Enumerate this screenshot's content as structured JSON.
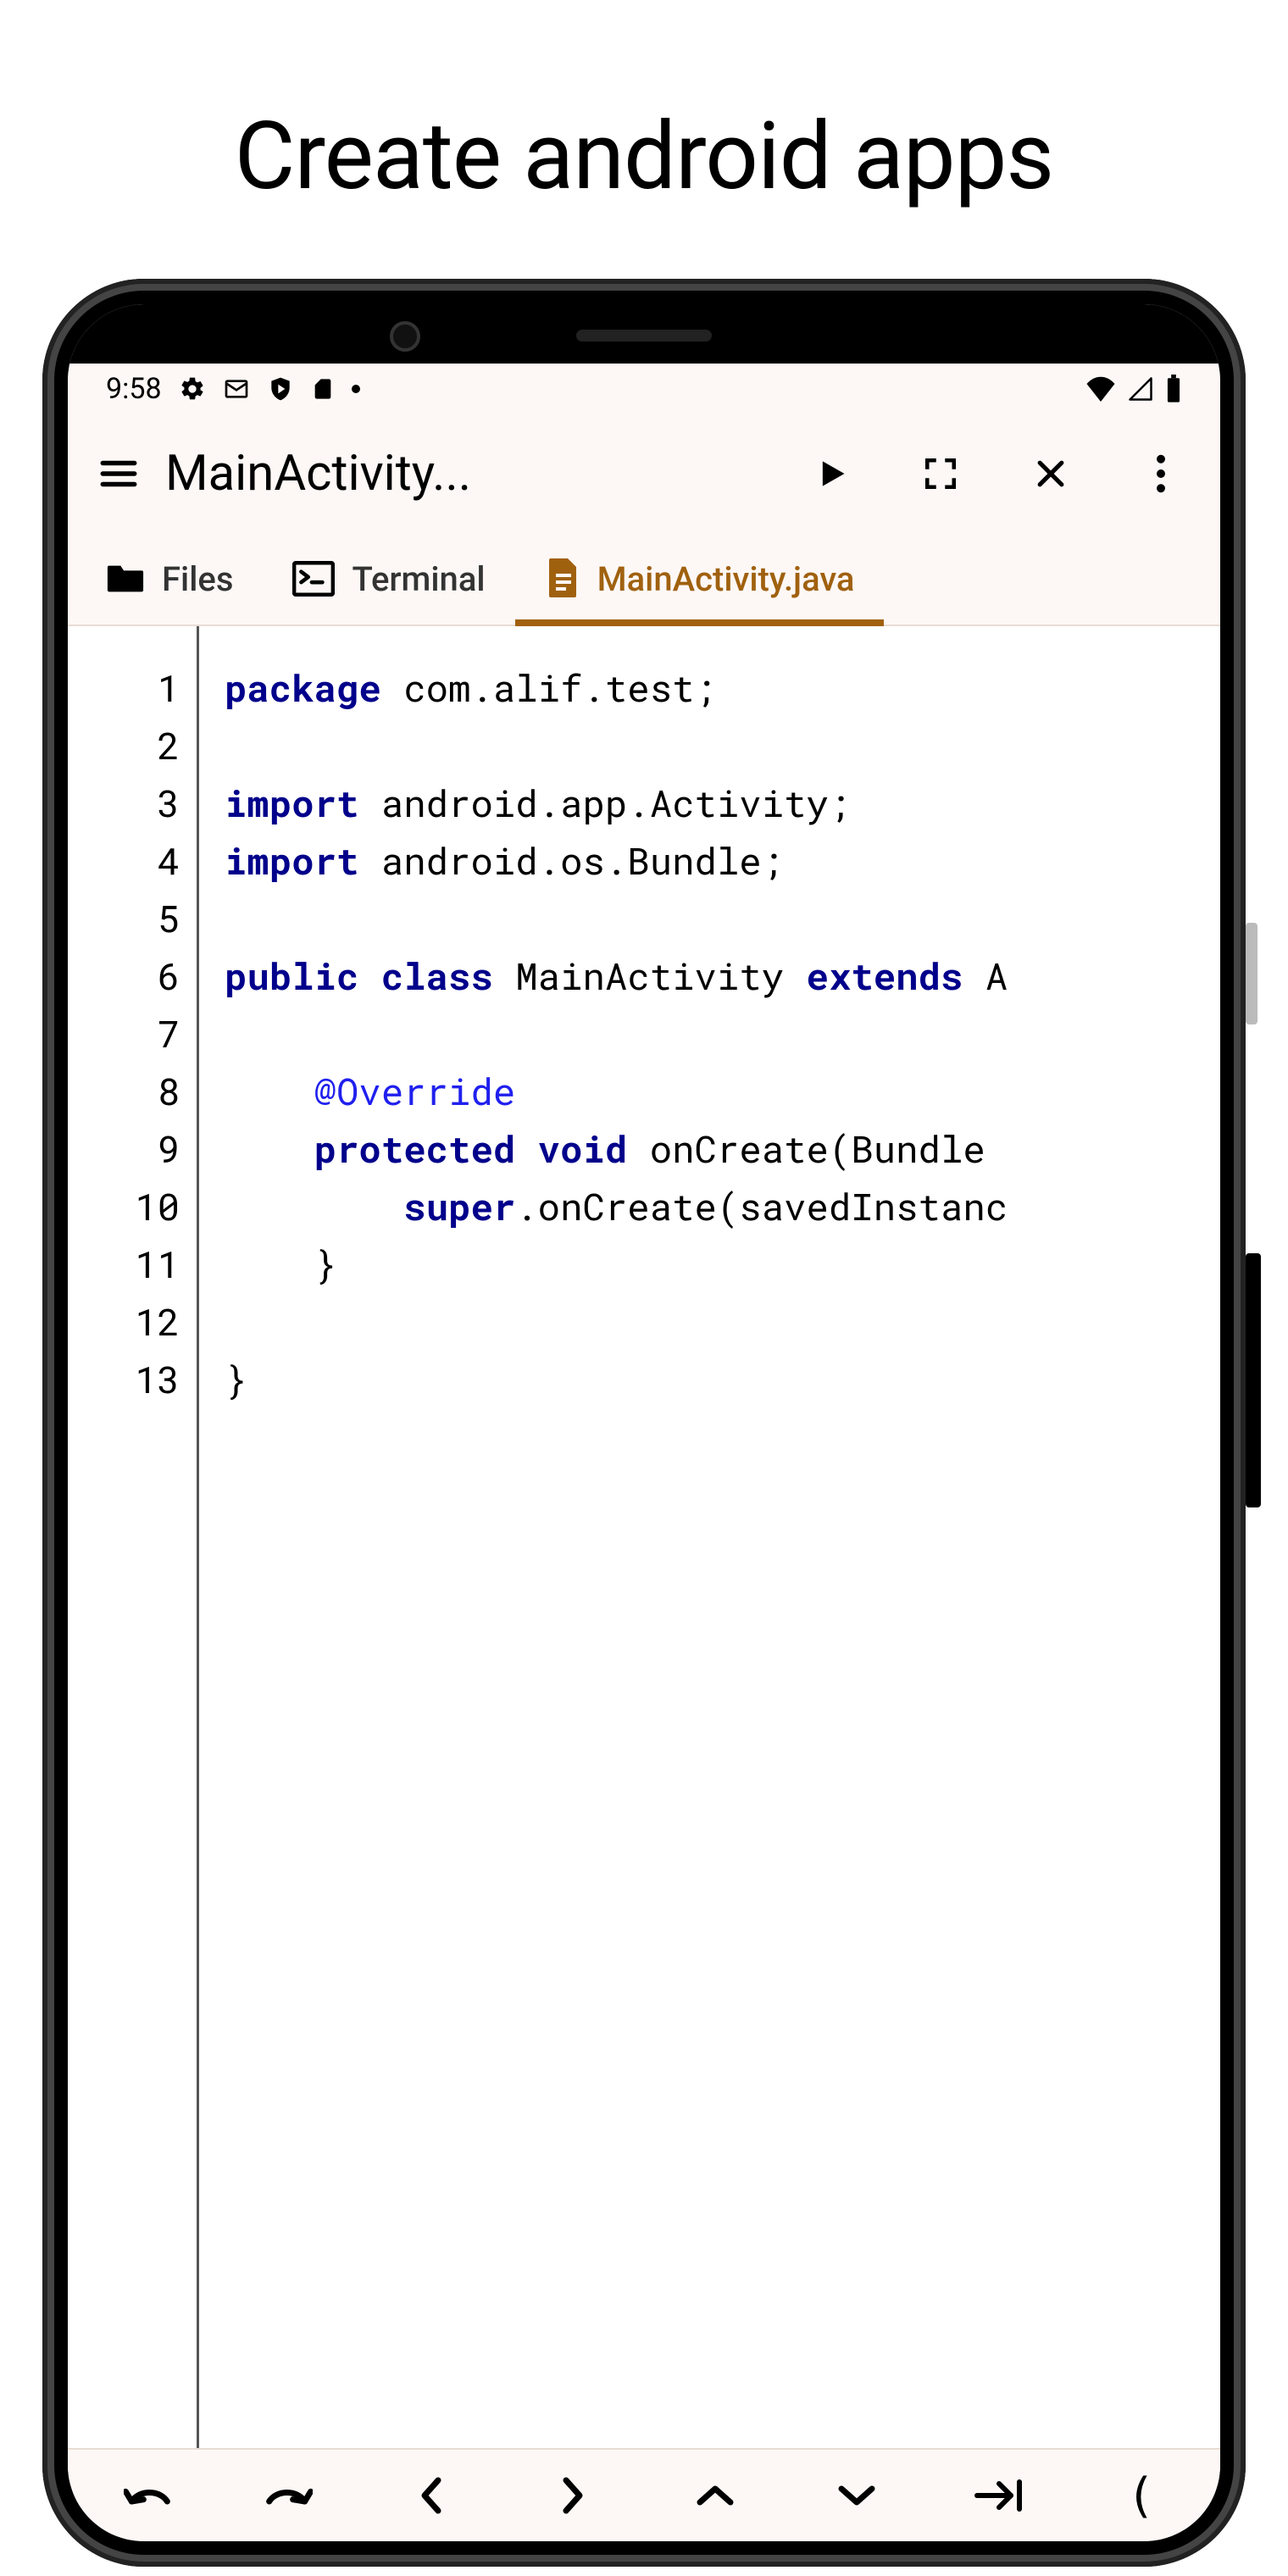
{
  "page_title": "Create android apps",
  "status_bar": {
    "time": "9:58"
  },
  "app_bar": {
    "title": "MainActivity..."
  },
  "tabs": {
    "files": "Files",
    "terminal": "Terminal",
    "active": "MainActivity.java"
  },
  "code": {
    "lines": [
      {
        "n": 1,
        "segs": [
          [
            "kw",
            "package"
          ],
          [
            "",
            " com.alif.test;"
          ]
        ]
      },
      {
        "n": 2,
        "segs": [
          [
            "",
            ""
          ]
        ]
      },
      {
        "n": 3,
        "segs": [
          [
            "kw",
            "import"
          ],
          [
            "",
            " android.app.Activity;"
          ]
        ]
      },
      {
        "n": 4,
        "segs": [
          [
            "kw",
            "import"
          ],
          [
            "",
            " android.os.Bundle;"
          ]
        ]
      },
      {
        "n": 5,
        "segs": [
          [
            "",
            ""
          ]
        ]
      },
      {
        "n": 6,
        "segs": [
          [
            "kw",
            "public"
          ],
          [
            "",
            " "
          ],
          [
            "kw",
            "class"
          ],
          [
            "",
            " MainActivity "
          ],
          [
            "kw",
            "extends"
          ],
          [
            "",
            " A"
          ]
        ]
      },
      {
        "n": 7,
        "segs": [
          [
            "",
            ""
          ]
        ]
      },
      {
        "n": 8,
        "segs": [
          [
            "",
            "    "
          ],
          [
            "ann",
            "@Override"
          ]
        ]
      },
      {
        "n": 9,
        "segs": [
          [
            "",
            "    "
          ],
          [
            "kw",
            "protected"
          ],
          [
            "",
            " "
          ],
          [
            "kw",
            "void"
          ],
          [
            "",
            " onCreate(Bundle"
          ]
        ]
      },
      {
        "n": 10,
        "segs": [
          [
            "",
            "        "
          ],
          [
            "kw",
            "super"
          ],
          [
            "",
            ".onCreate(savedInstanc"
          ]
        ]
      },
      {
        "n": 11,
        "segs": [
          [
            "",
            "    }"
          ]
        ]
      },
      {
        "n": 12,
        "segs": [
          [
            "",
            ""
          ]
        ]
      },
      {
        "n": 13,
        "segs": [
          [
            "",
            "}"
          ]
        ]
      }
    ]
  },
  "bottom_bar": {
    "paren": "("
  }
}
